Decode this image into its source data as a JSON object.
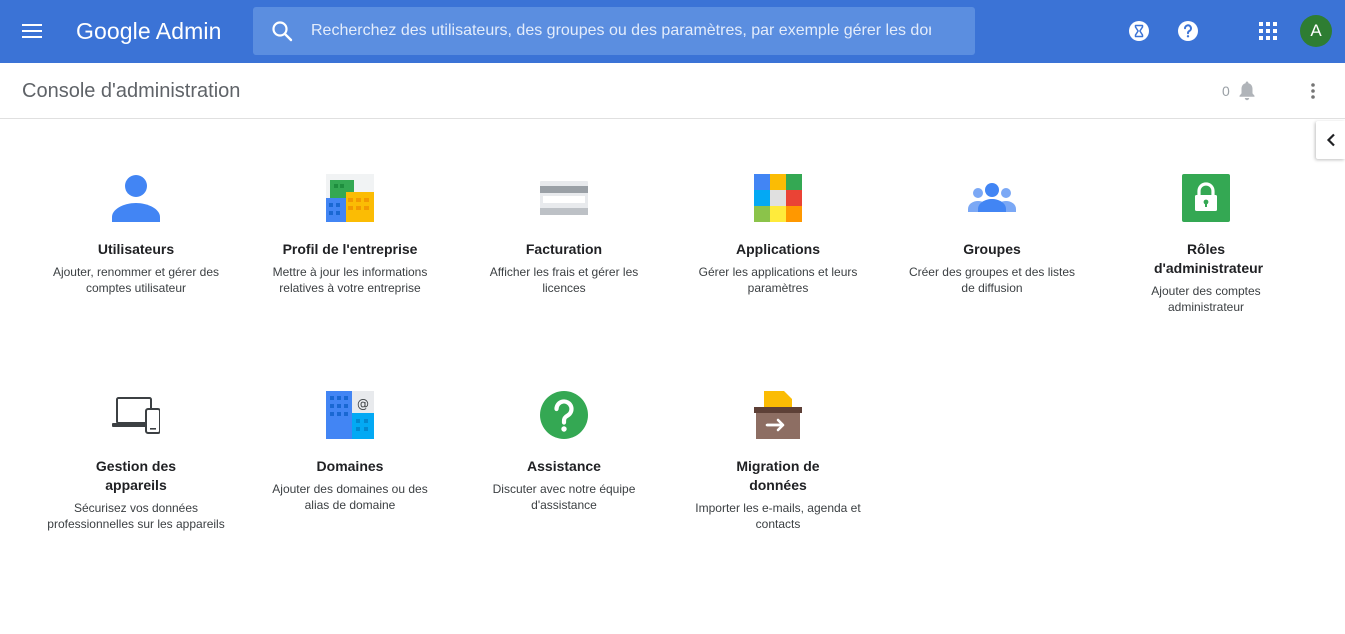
{
  "header": {
    "logo_google": "Google",
    "logo_admin": "Admin",
    "search_placeholder": "Recherchez des utilisateurs, des groupes ou des paramètres, par exemple gérer les dor",
    "avatar_letter": "A",
    "bar_color": "#3b73d6"
  },
  "subheader": {
    "title": "Console d'administration",
    "notification_count": "0"
  },
  "tiles": [
    {
      "title": "Utilisateurs",
      "description": "Ajouter, renommer et gérer des comptes utilisateur",
      "icon": "user-icon"
    },
    {
      "title": "Profil de l'entreprise",
      "description": "Mettre à jour les informations relatives à votre entreprise",
      "icon": "company-buildings-icon"
    },
    {
      "title": "Facturation",
      "description": "Afficher les frais et gérer les licences",
      "icon": "credit-card-icon"
    },
    {
      "title": "Applications",
      "description": "Gérer les applications et leurs paramètres",
      "icon": "apps-grid-icon"
    },
    {
      "title": "Groupes",
      "description": "Créer des groupes et des listes de diffusion",
      "icon": "group-icon"
    },
    {
      "title": "Rôles d'administrateur",
      "description": "Ajouter des comptes administrateur",
      "icon": "lock-icon"
    },
    {
      "title": "Gestion des appareils",
      "description": "Sécurisez vos données professionnelles sur les appareils",
      "icon": "devices-icon"
    },
    {
      "title": "Domaines",
      "description": "Ajouter des domaines ou des alias de domaine",
      "icon": "domain-building-icon"
    },
    {
      "title": "Assistance",
      "description": "Discuter avec notre équipe d'assistance",
      "icon": "help-circle-icon"
    },
    {
      "title": "Migration de données",
      "description": "Importer les e-mails, agenda et contacts",
      "icon": "migration-box-icon"
    }
  ]
}
